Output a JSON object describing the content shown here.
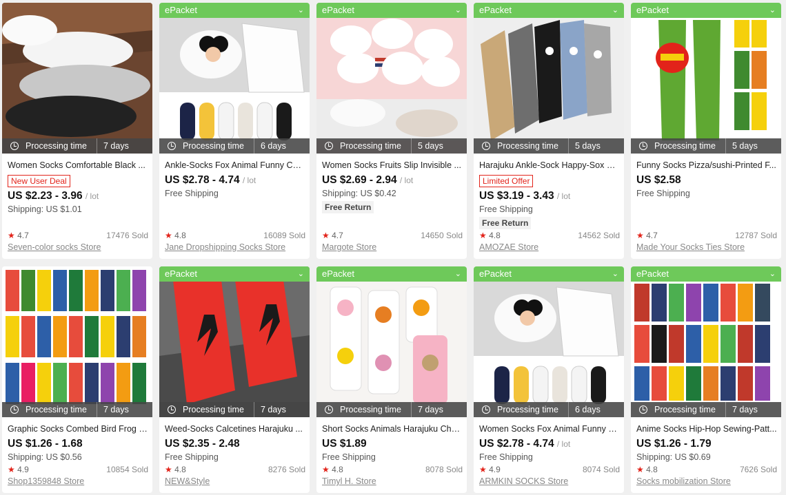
{
  "labels": {
    "processing": "Processing time",
    "epacket": "ePacket",
    "unit": "/ lot"
  },
  "colors": {
    "epacket_green": "#6ec95a",
    "price_tag_red": "#e2231a"
  },
  "products": [
    {
      "epacket": false,
      "days": "7 days",
      "title": "Women Socks Comfortable Black ...",
      "tag": "New User Deal",
      "price": "US $2.23 - 3.96",
      "unit": "/ lot",
      "shipping": "Shipping: US $1.01",
      "free_return": "",
      "rating": "4.7",
      "sold": "17476 Sold",
      "store": "Seven-color socks Store",
      "image_icon": "socks-photo-black-grey-white"
    },
    {
      "epacket": true,
      "days": "6 days",
      "title": "Ankle-Socks Fox Animal Funny Cat ...",
      "tag": "",
      "price": "US $2.78 - 4.74",
      "unit": "/ lot",
      "shipping": "Free Shipping",
      "free_return": "",
      "rating": "4.8",
      "sold": "16089 Sold",
      "store": "Jane Dropshipping Socks Store",
      "image_icon": "cartoon-ankle-socks-photo"
    },
    {
      "epacket": true,
      "days": "5 days",
      "title": "Women Socks Fruits Slip Invisible ...",
      "tag": "",
      "price": "US $2.69 - 2.94",
      "unit": "/ lot",
      "shipping": "Shipping: US $0.42",
      "free_return": "Free Return",
      "rating": "4.7",
      "sold": "14650 Sold",
      "store": "Margote Store",
      "image_icon": "white-invisible-socks-photo"
    },
    {
      "epacket": true,
      "days": "5 days",
      "title": "Harajuku Ankle-Sock Happy-Sox C...",
      "tag": "Limited Offer",
      "price": "US $3.19 - 3.43",
      "unit": "/ lot",
      "shipping": "Free Shipping",
      "free_return": "Free Return",
      "rating": "4.8",
      "sold": "14562 Sold",
      "store": "AMOZAE Store",
      "image_icon": "animal-ankle-socks-photo"
    },
    {
      "epacket": true,
      "days": "5 days",
      "title": "Funny Socks Pizza/sushi-Printed F...",
      "tag": "",
      "price": "US $2.58",
      "unit": "",
      "shipping": "Free Shipping",
      "free_return": "",
      "rating": "4.7",
      "sold": "12787 Sold",
      "store": "Made Your Socks Ties Store",
      "image_icon": "printed-snack-socks-photo"
    },
    {
      "epacket": false,
      "days": "7 days",
      "title": "Graphic Socks Combed Bird Frog C...",
      "tag": "",
      "price": "US $1.26 - 1.68",
      "unit": "",
      "shipping": "Shipping: US $0.56",
      "free_return": "",
      "rating": "4.9",
      "sold": "10854 Sold",
      "store": "Shop1359848 Store",
      "image_icon": "colorful-graphic-socks-photo"
    },
    {
      "epacket": true,
      "days": "7 days",
      "title": "Weed-Socks Calcetines Harajuku ...",
      "tag": "",
      "price": "US $2.35 - 2.48",
      "unit": "",
      "shipping": "Free Shipping",
      "free_return": "",
      "rating": "4.8",
      "sold": "8276 Sold",
      "store": "NEW&Style",
      "image_icon": "red-leaf-socks-photo"
    },
    {
      "epacket": true,
      "days": "7 days",
      "title": "Short Socks Animals Harajuku Cha...",
      "tag": "",
      "price": "US $1.89",
      "unit": "",
      "shipping": "Free Shipping",
      "free_return": "",
      "rating": "4.8",
      "sold": "8078 Sold",
      "store": "Timyl H. Store",
      "image_icon": "cartoon-short-socks-photo"
    },
    {
      "epacket": true,
      "days": "6 days",
      "title": "Women Socks Fox Animal Funny D...",
      "tag": "",
      "price": "US $2.78 - 4.74",
      "unit": "/ lot",
      "shipping": "Free Shipping",
      "free_return": "",
      "rating": "4.9",
      "sold": "8074 Sold",
      "store": "ARMKIN SOCKS Store",
      "image_icon": "cartoon-ankle-socks-photo"
    },
    {
      "epacket": true,
      "days": "7 days",
      "title": "Anime Socks Hip-Hop Sewing-Patt...",
      "tag": "",
      "price": "US $1.26 - 1.79",
      "unit": "",
      "shipping": "Shipping: US $0.69",
      "free_return": "",
      "rating": "4.8",
      "sold": "7626 Sold",
      "store": "Socks mobilization Store",
      "image_icon": "superhero-socks-photo"
    }
  ]
}
